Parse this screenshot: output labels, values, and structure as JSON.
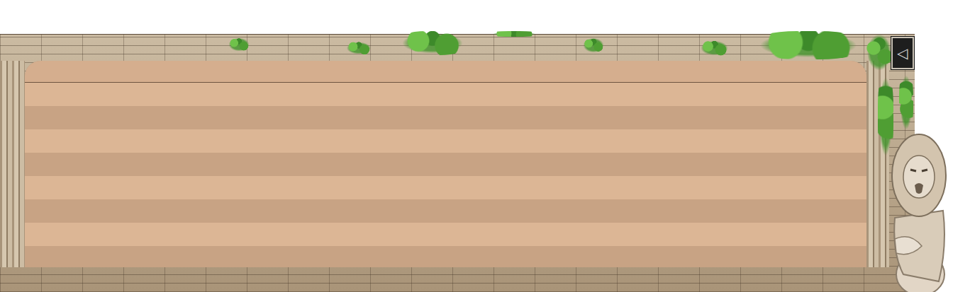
{
  "panel": {
    "header": "",
    "rows": [
      "",
      "",
      "",
      "",
      "",
      "",
      "",
      ""
    ],
    "collapse_button": "◁"
  }
}
